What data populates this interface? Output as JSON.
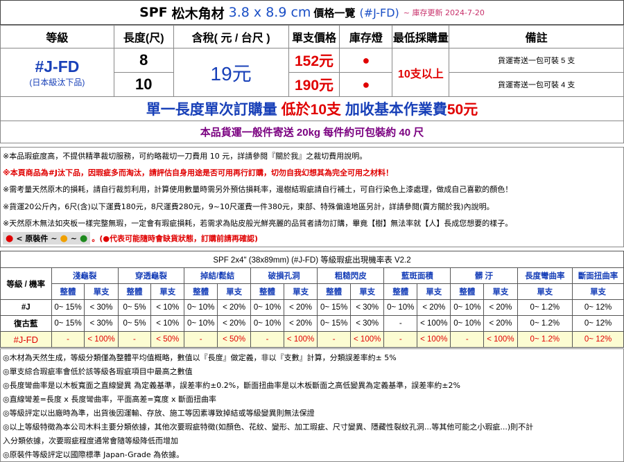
{
  "header": {
    "brand": "SPF",
    "name": "松木角材",
    "size": "3.8 x 8.9 cm",
    "list": "價格一覽",
    "code": "(#J-FD)",
    "update": "~ 庫存更新 2024-7-20"
  },
  "price_table": {
    "headers": [
      "等級",
      "長度(尺)",
      "含稅( 元 / 台尺 )",
      "單支價格",
      "庫存燈",
      "最低採購量",
      "備註"
    ],
    "grade": "#J-FD",
    "grade_sub": "(日本級汰下品)",
    "unit_price": "19元",
    "min_qty": "10支以上",
    "rows": [
      {
        "length": "8",
        "price": "152元",
        "stock": "●",
        "note": "貨運寄送一包可裝 5 支"
      },
      {
        "length": "10",
        "price": "190元",
        "stock": "●",
        "note": "貨運寄送一包可裝 4 支"
      }
    ],
    "fee_line": {
      "a": "單一長度單次訂購量 ",
      "b": "低於10支",
      "c": " 加收基本作業費",
      "d": "50元"
    },
    "ship_line": "本品貨運一般件寄送 20kg 每件約可包裝約 40 尺"
  },
  "notes": [
    "※本品瑕疵度高，不提供精準裁切服務，可約略裁切一刀費用 10 元，詳請參閱『關於我』之裁切費用說明。",
    "※本頁商品為#J汰下品，因瑕疵多而淘汰，請評估自身用途是否可用再行訂購，切勿自我幻想其為完全可用之材料！",
    "※需考量天然原木的損耗，請自行裁剪利用，計算使用數量時需另外預估損耗率，邊樹結瑕疵請自行補土，可自行染色上漆處理，做成自己喜歡的顏色！",
    "※貨運20公斤內，6尺(含)以下運費180元，8尺運費280元，9~10尺運費一件380元，東部、特殊偏遠地區另計，詳請參閱(賣方關於我)內說明。",
    "※天然原木無法如夾板一樣完整無瑕，一定會有瑕疵損耗，若需求為貼皮般光鮮亮麗的品質者請勿訂購，畢竟【樹】無法率就【人】長成您想要的樣子。"
  ],
  "legend": {
    "label": "< 原裝件 ~",
    "sep": "~",
    "warn": "。(●代表可能隨時會缺貨狀態，訂購前請再確認)"
  },
  "defect_table": {
    "title": "SPF 2x4\" (38x89mm) (#J-FD) 等級瑕疵出現機率表 V2.2",
    "corner": "等級 / 機率",
    "groups": [
      "淺龜裂",
      "穿透龜裂",
      "掉結/鬆結",
      "破損孔洞",
      "粗糙閃皮",
      "藍斑面積",
      "髒 汙",
      "長度彎曲率",
      "斷面扭曲率"
    ],
    "sub_whole": "整體",
    "sub_single": "單支",
    "rows": [
      {
        "grade": "#J",
        "cells": [
          "0~ 15%",
          "< 30%",
          "0~ 5%",
          "< 10%",
          "0~ 10%",
          "< 20%",
          "0~ 10%",
          "< 20%",
          "0~ 15%",
          "< 30%",
          "0~ 10%",
          "< 20%",
          "0~ 10%",
          "< 20%",
          "0~ 1.2%",
          "0~ 12%"
        ]
      },
      {
        "grade": "復古藍",
        "cells": [
          "0~ 15%",
          "< 30%",
          "0~ 5%",
          "< 10%",
          "0~ 10%",
          "< 20%",
          "0~ 10%",
          "< 20%",
          "0~ 15%",
          "< 30%",
          "-",
          "< 100%",
          "0~ 10%",
          "< 20%",
          "0~ 1.2%",
          "0~ 12%"
        ]
      },
      {
        "grade": "#J-FD",
        "cells": [
          "-",
          "< 100%",
          "-",
          "< 50%",
          "-",
          "< 50%",
          "-",
          "< 100%",
          "-",
          "< 100%",
          "-",
          "< 100%",
          "-",
          "< 100%",
          "0~ 1.2%",
          "0~ 12%"
        ]
      }
    ]
  },
  "bottom_notes": [
    "◎木材為天然生成，等級分類僅為整體平均值概略，數值以『長度』做定義，非以『支數』計算，分類誤差率約± 5%",
    "◎單支綜合瑕疵率會低於該等級各瑕疵項目中最高之數值",
    "◎長度彎曲率是以木板寬面之直線變異 為定義基準，誤差率約±0.2%，斷面扭曲率是以木板斷面之高低變異為定義基準，誤差率約±2%",
    "◎直線彎差=長度 x 長度彎曲率，平面高差=寬度 x 斷面扭曲率",
    "◎等級評定以出廠時為準，出貨後因運輸、存放、施工等因素導致掉結或等級變異則無法保證",
    "◎以上等級特徵為本公司木料主要分類依據，其他次要瑕疵特徵(如顏色、花紋、變形、加工瑕疵、尺寸變異、隱藏性裂紋孔洞...等其他可能之小瑕疵...)則不計",
    "入分類依據，次要瑕疵程度通常會隨等級降低而增加",
    "◎原裝件等級評定以國際標準 Japan-Grade 為依據。"
  ],
  "colors": {
    "blue": "#1840b8",
    "red": "#e00000",
    "purple": "#7a0080",
    "orange": "#f0a000",
    "green": "#1f8a1f",
    "highlight": "#fcfcd2"
  }
}
